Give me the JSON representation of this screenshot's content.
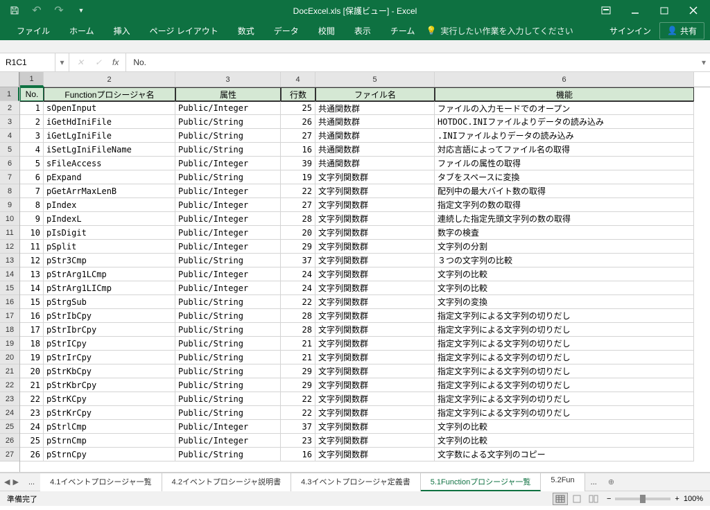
{
  "title": "DocExcel.xls [保護ビュー] - Excel",
  "qat": {
    "undo": "↶",
    "redo": "↷"
  },
  "tabs": [
    "ファイル",
    "ホーム",
    "挿入",
    "ページ レイアウト",
    "数式",
    "データ",
    "校閲",
    "表示",
    "チーム"
  ],
  "tellme": "実行したい作業を入力してください",
  "signin": "サインイン",
  "share": "共有",
  "namebox": "R1C1",
  "formula": "No.",
  "cols": [
    "1",
    "2",
    "3",
    "4",
    "5",
    "6"
  ],
  "rows": [
    "1",
    "2",
    "3",
    "4",
    "5",
    "6",
    "7",
    "8",
    "9",
    "10",
    "11",
    "12",
    "13",
    "14",
    "15",
    "16",
    "17",
    "18",
    "19",
    "20",
    "21",
    "22",
    "23",
    "24",
    "25",
    "26",
    "27"
  ],
  "header": [
    "No.",
    "Functionプロシージャ名",
    "属性",
    "行数",
    "ファイル名",
    "機能"
  ],
  "chart_data": {
    "type": "table",
    "title": "Functionプロシージャ一覧",
    "columns": [
      "No.",
      "Functionプロシージャ名",
      "属性",
      "行数",
      "ファイル名",
      "機能"
    ],
    "rows": [
      [
        1,
        "sOpenInput",
        "Public/Integer",
        25,
        "共通関数群",
        "ファイルの入力モードでのオープン"
      ],
      [
        2,
        "iGetHdIniFile",
        "Public/String",
        26,
        "共通関数群",
        "HOTDOC.INIファイルよりデータの読み込み"
      ],
      [
        3,
        "iGetLgIniFile",
        "Public/String",
        27,
        "共通関数群",
        ".INIファイルよりデータの読み込み"
      ],
      [
        4,
        "iSetLgIniFileName",
        "Public/String",
        16,
        "共通関数群",
        "対応言語によってファイル名の取得"
      ],
      [
        5,
        "sFileAccess",
        "Public/Integer",
        39,
        "共通関数群",
        "ファイルの属性の取得"
      ],
      [
        6,
        "pExpand",
        "Public/String",
        19,
        "文字列関数群",
        "タブをスペースに変換"
      ],
      [
        7,
        "pGetArrMaxLenB",
        "Public/Integer",
        22,
        "文字列関数群",
        "配列中の最大バイト数の取得"
      ],
      [
        8,
        "pIndex",
        "Public/Integer",
        27,
        "文字列関数群",
        "指定文字列の数の取得"
      ],
      [
        9,
        "pIndexL",
        "Public/Integer",
        28,
        "文字列関数群",
        "連続した指定先頭文字列の数の取得"
      ],
      [
        10,
        "pIsDigit",
        "Public/Integer",
        20,
        "文字列関数群",
        "数字の検査"
      ],
      [
        11,
        "pSplit",
        "Public/Integer",
        29,
        "文字列関数群",
        "文字列の分割"
      ],
      [
        12,
        "pStr3Cmp",
        "Public/String",
        37,
        "文字列関数群",
        "３つの文字列の比較"
      ],
      [
        13,
        "pStrArg1LCmp",
        "Public/Integer",
        24,
        "文字列関数群",
        "文字列の比較"
      ],
      [
        14,
        "pStrArg1LICmp",
        "Public/Integer",
        24,
        "文字列関数群",
        "文字列の比較"
      ],
      [
        15,
        "pStrgSub",
        "Public/String",
        22,
        "文字列関数群",
        "文字列の変換"
      ],
      [
        16,
        "pStrIbCpy",
        "Public/String",
        28,
        "文字列関数群",
        "指定文字列による文字列の切りだし"
      ],
      [
        17,
        "pStrIbrCpy",
        "Public/String",
        28,
        "文字列関数群",
        "指定文字列による文字列の切りだし"
      ],
      [
        18,
        "pStrICpy",
        "Public/String",
        21,
        "文字列関数群",
        "指定文字列による文字列の切りだし"
      ],
      [
        19,
        "pStrIrCpy",
        "Public/String",
        21,
        "文字列関数群",
        "指定文字列による文字列の切りだし"
      ],
      [
        20,
        "pStrKbCpy",
        "Public/String",
        29,
        "文字列関数群",
        "指定文字列による文字列の切りだし"
      ],
      [
        21,
        "pStrKbrCpy",
        "Public/String",
        29,
        "文字列関数群",
        "指定文字列による文字列の切りだし"
      ],
      [
        22,
        "pStrKCpy",
        "Public/String",
        22,
        "文字列関数群",
        "指定文字列による文字列の切りだし"
      ],
      [
        23,
        "pStrKrCpy",
        "Public/String",
        22,
        "文字列関数群",
        "指定文字列による文字列の切りだし"
      ],
      [
        24,
        "pStrlCmp",
        "Public/Integer",
        37,
        "文字列関数群",
        "文字列の比較"
      ],
      [
        25,
        "pStrnCmp",
        "Public/Integer",
        23,
        "文字列関数群",
        "文字列の比較"
      ],
      [
        26,
        "pStrnCpy",
        "Public/String",
        16,
        "文字列関数群",
        "文字数による文字列のコピー"
      ]
    ]
  },
  "sheets": {
    "items": [
      "4.1イベントプロシージャ一覧",
      "4.2イベントプロシージャ説明書",
      "4.3イベントプロシージャ定義書",
      "5.1Functionプロシージャ一覧",
      "5.2Fun"
    ],
    "active": 3
  },
  "status": "準備完了",
  "zoom": "100%"
}
